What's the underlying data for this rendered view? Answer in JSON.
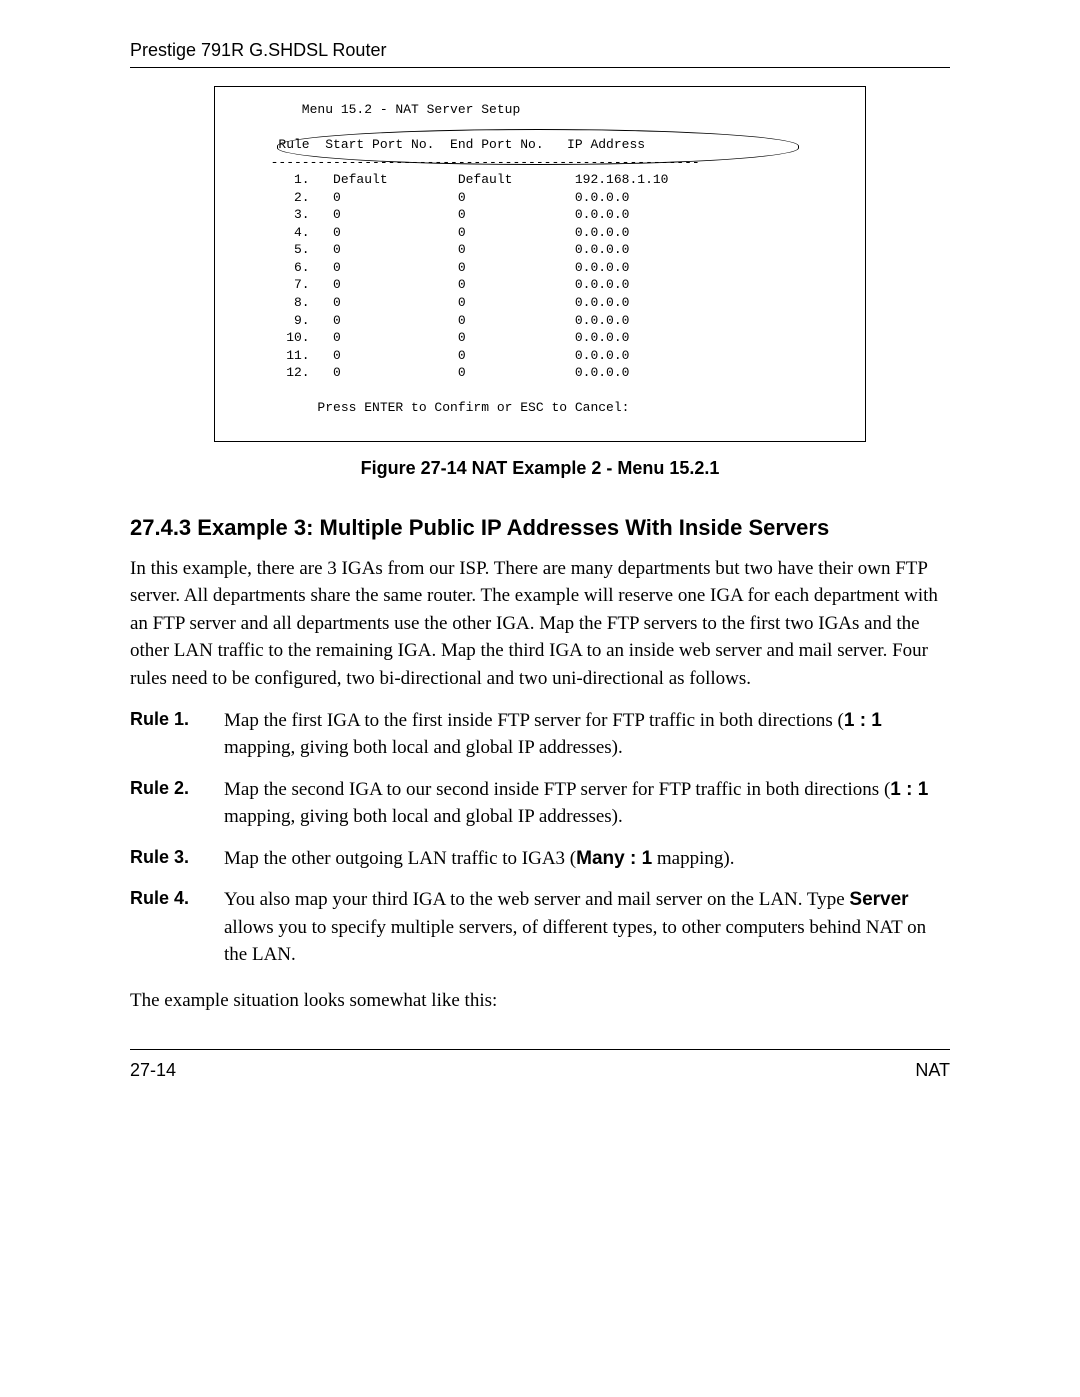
{
  "header": {
    "running_title": "Prestige 791R G.SHDSL Router"
  },
  "screen": {
    "menu_title": "Menu 15.2 - NAT Server Setup",
    "col_rule": "Rule",
    "col_start": "Start Port No.",
    "col_end": "End Port No.",
    "col_ip": "IP Address",
    "rows": [
      {
        "n": "1.",
        "s": "Default",
        "e": "Default",
        "ip": "192.168.1.10"
      },
      {
        "n": "2.",
        "s": "0",
        "e": "0",
        "ip": "0.0.0.0"
      },
      {
        "n": "3.",
        "s": "0",
        "e": "0",
        "ip": "0.0.0.0"
      },
      {
        "n": "4.",
        "s": "0",
        "e": "0",
        "ip": "0.0.0.0"
      },
      {
        "n": "5.",
        "s": "0",
        "e": "0",
        "ip": "0.0.0.0"
      },
      {
        "n": "6.",
        "s": "0",
        "e": "0",
        "ip": "0.0.0.0"
      },
      {
        "n": "7.",
        "s": "0",
        "e": "0",
        "ip": "0.0.0.0"
      },
      {
        "n": "8.",
        "s": "0",
        "e": "0",
        "ip": "0.0.0.0"
      },
      {
        "n": "9.",
        "s": "0",
        "e": "0",
        "ip": "0.0.0.0"
      },
      {
        "n": "10.",
        "s": "0",
        "e": "0",
        "ip": "0.0.0.0"
      },
      {
        "n": "11.",
        "s": "0",
        "e": "0",
        "ip": "0.0.0.0"
      },
      {
        "n": "12.",
        "s": "0",
        "e": "0",
        "ip": "0.0.0.0"
      }
    ],
    "prompt": "Press ENTER to Confirm or ESC to Cancel:"
  },
  "figure": {
    "caption": "Figure 27-14 NAT Example 2 - Menu 15.2.1"
  },
  "section": {
    "heading": "27.4.3 Example 3: Multiple Public IP Addresses With Inside Servers",
    "para1": "In this example, there are 3 IGAs from our ISP. There are many departments but two have their own FTP server. All departments share the same router. The example will reserve one IGA for each department with an FTP server and all departments use the other IGA. Map the FTP servers to the first two IGAs and the other LAN traffic to the remaining IGA. Map the third IGA to an inside web server and mail server. Four rules need to be configured, two bi-directional and two uni-directional as follows."
  },
  "rules": [
    {
      "label": "Rule 1.",
      "pre": "Map the first IGA to the first inside FTP server for FTP traffic in both directions (",
      "bold": "1 : 1",
      "post": " mapping, giving both local and global IP addresses)."
    },
    {
      "label": "Rule 2.",
      "pre": "Map the second IGA to our second inside FTP server for FTP traffic in both directions (",
      "bold": "1 : 1",
      "post": " mapping, giving both local and global IP addresses)."
    },
    {
      "label": "Rule 3.",
      "pre": "Map the other outgoing LAN traffic to IGA3 (",
      "bold": "Many : 1",
      "post": " mapping)."
    },
    {
      "label": "Rule 4.",
      "pre": "You also map your third IGA to the web server and mail server on the LAN. Type ",
      "bold": "Server",
      "post": " allows you to specify multiple servers, of different types, to other computers behind NAT on the LAN."
    }
  ],
  "closing": {
    "line": "The example situation looks somewhat like this:"
  },
  "footer": {
    "left": "27-14",
    "right": "NAT"
  }
}
